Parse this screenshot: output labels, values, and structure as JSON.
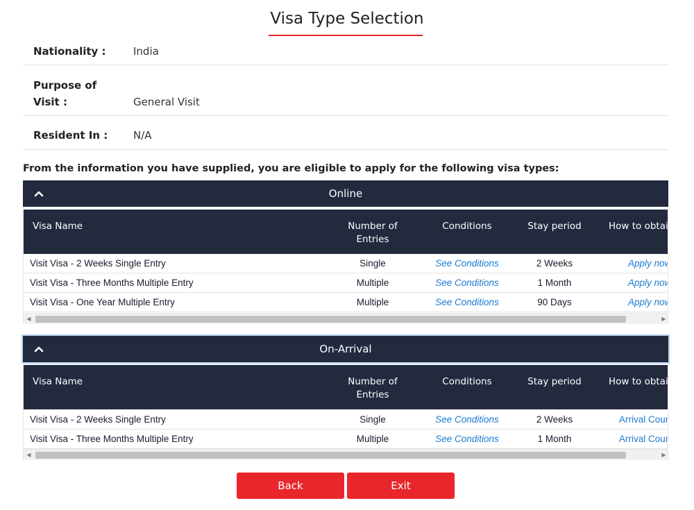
{
  "page": {
    "title": "Visa Type Selection"
  },
  "info": {
    "nationality_label": "Nationality :",
    "nationality_value": "India",
    "purpose_label": "Purpose of Visit :",
    "purpose_value": "General Visit",
    "resident_label": "Resident In :",
    "resident_value": "N/A"
  },
  "eligible_text": "From the information you have supplied, you are eligible to apply for the following visa types:",
  "columns": {
    "visa_name": "Visa Name",
    "entries": "Number of Entries",
    "conditions": "Conditions",
    "stay": "Stay period",
    "obtain": "How to obtain"
  },
  "online": {
    "title": "Online",
    "rows": [
      {
        "name": "Visit Visa - 2 Weeks Single Entry",
        "entries": "Single",
        "conditions": "See Conditions",
        "stay": "2 Weeks",
        "obtain": "Apply now"
      },
      {
        "name": "Visit Visa - Three Months Multiple Entry",
        "entries": "Multiple",
        "conditions": "See Conditions",
        "stay": "1 Month",
        "obtain": "Apply now"
      },
      {
        "name": "Visit Visa - One Year Multiple Entry",
        "entries": "Multiple",
        "conditions": "See Conditions",
        "stay": "90 Days",
        "obtain": "Apply now"
      }
    ]
  },
  "arrival": {
    "title": "On-Arrival",
    "rows": [
      {
        "name": "Visit Visa - 2 Weeks Single Entry",
        "entries": "Single",
        "conditions": "See Conditions",
        "stay": "2 Weeks",
        "obtain": "Arrival Counter"
      },
      {
        "name": "Visit Visa - Three Months Multiple Entry",
        "entries": "Multiple",
        "conditions": "See Conditions",
        "stay": "1 Month",
        "obtain": "Arrival Counter"
      }
    ]
  },
  "buttons": {
    "back": "Back",
    "exit": "Exit"
  },
  "colors": {
    "header_bg": "#232a3e",
    "accent_red": "#e8262b",
    "link_blue": "#1a7bd0"
  }
}
